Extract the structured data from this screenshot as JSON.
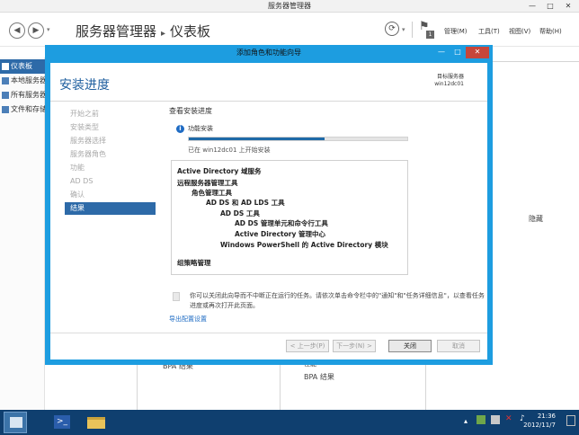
{
  "window": {
    "title": "服务器管理器",
    "controls": [
      "—",
      "□",
      "✕"
    ]
  },
  "header": {
    "breadcrumb_app": "服务器管理器",
    "breadcrumb_page": "仪表板",
    "menus": [
      "管理(M)",
      "工具(T)",
      "视图(V)",
      "帮助(H)"
    ],
    "notification_count": "1"
  },
  "leftnav": {
    "items": [
      {
        "label": "仪表板",
        "selected": true
      },
      {
        "label": "本地服务器",
        "selected": false
      },
      {
        "label": "所有服务器",
        "selected": false
      },
      {
        "label": "文件和存储服务",
        "selected": false
      }
    ]
  },
  "background": {
    "hide_label": "隐藏",
    "panel1_label": "BPA 结果",
    "panel2_label1": "性能",
    "panel2_label2": "BPA 结果"
  },
  "dialog": {
    "title": "添加角色和功能向导",
    "heading": "安装进度",
    "target_server_label": "目标服务器",
    "target_server_name": "win12dc01",
    "steps": [
      {
        "label": "开始之前",
        "active": false
      },
      {
        "label": "安装类型",
        "active": false
      },
      {
        "label": "服务器选择",
        "active": false
      },
      {
        "label": "服务器角色",
        "active": false
      },
      {
        "label": "功能",
        "active": false
      },
      {
        "label": "AD DS",
        "active": false
      },
      {
        "label": "确认",
        "active": false
      },
      {
        "label": "结果",
        "active": true
      }
    ],
    "section_title": "查看安装进度",
    "status_text": "功能安装",
    "progress_fraction": 0.62,
    "progress_text": "已在 win12dc01 上开始安装",
    "results": [
      {
        "text": "Active Directory 域服务",
        "indent": 0
      },
      {
        "text": "远程服务器管理工具",
        "indent": 0
      },
      {
        "text": "角色管理工具",
        "indent": 1
      },
      {
        "text": "AD DS 和 AD LDS 工具",
        "indent": 2
      },
      {
        "text": "AD DS 工具",
        "indent": 3
      },
      {
        "text": "AD DS 管理单元和命令行工具",
        "indent": 4
      },
      {
        "text": "Active Directory 管理中心",
        "indent": 4
      },
      {
        "text": "Windows PowerShell 的 Active Directory 模块",
        "indent": 3
      },
      {
        "text": "组策略管理",
        "indent": 0
      }
    ],
    "note_text": "你可以关闭此向导而不中断正在运行的任务。请依次单击命令栏中的\"通知\"和\"任务详细信息\"，以查看任务进度或再次打开此页面。",
    "export_link": "导出配置设置",
    "buttons": {
      "prev": "< 上一步(P)",
      "next": "下一步(N) >",
      "close": "关闭",
      "cancel": "取消"
    }
  },
  "taskbar": {
    "time": "21:36",
    "date": "2012/11/7"
  },
  "colors": {
    "dialog_frame": "#1d9de0",
    "accent": "#2d6aa8",
    "taskbar": "#0f3f6f",
    "heading": "#1f5f9f"
  }
}
